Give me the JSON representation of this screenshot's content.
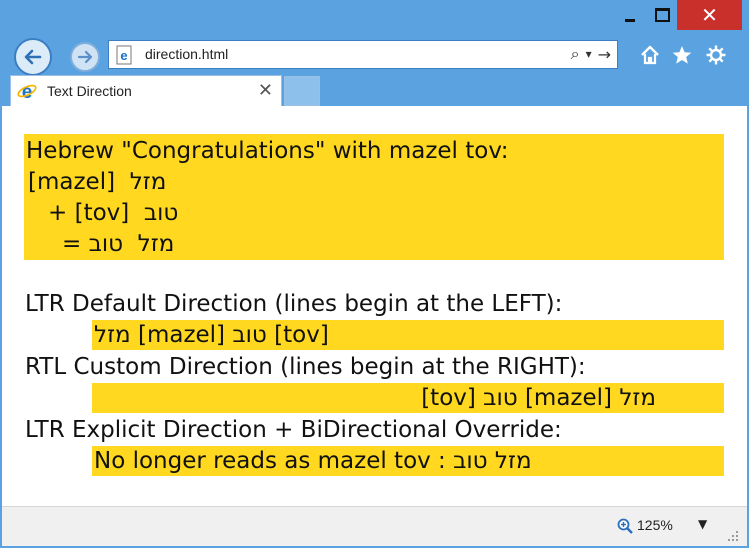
{
  "window": {
    "close_glyph": "✕",
    "frame_color": "#5aa3e0",
    "close_color": "#c9302c"
  },
  "toolbar": {
    "address": "direction.html",
    "search_glyph": "⌕",
    "dropdown_glyph": "▾",
    "go_glyph": "→"
  },
  "tab": {
    "title": "Text Direction",
    "close_glyph": "✕"
  },
  "content": {
    "highlight_color": "#ffd81f",
    "block1": {
      "line1": "Hebrew \"Congratulations\" with mazel tov:",
      "line2": "מזל  [mazel]",
      "line3": "טוב  [tov] +",
      "line4": "מזל  טוב ="
    },
    "ltr_default_label": "LTR Default Direction (lines begin at the LEFT):",
    "ltr_default_text": "מזל [mazel] טוב [tov]",
    "rtl_custom_label": "RTL Custom Direction (lines begin at the RIGHT):",
    "rtl_custom_text": "מזל [mazel] טוב [tov]",
    "bdo_label": "LTR Explicit Direction + BiDirectional Override:",
    "bdo_text": "No longer reads as mazel tov : בוט לזמ"
  },
  "status": {
    "zoom": "125%",
    "zoom_dropdown_glyph": "▼"
  }
}
